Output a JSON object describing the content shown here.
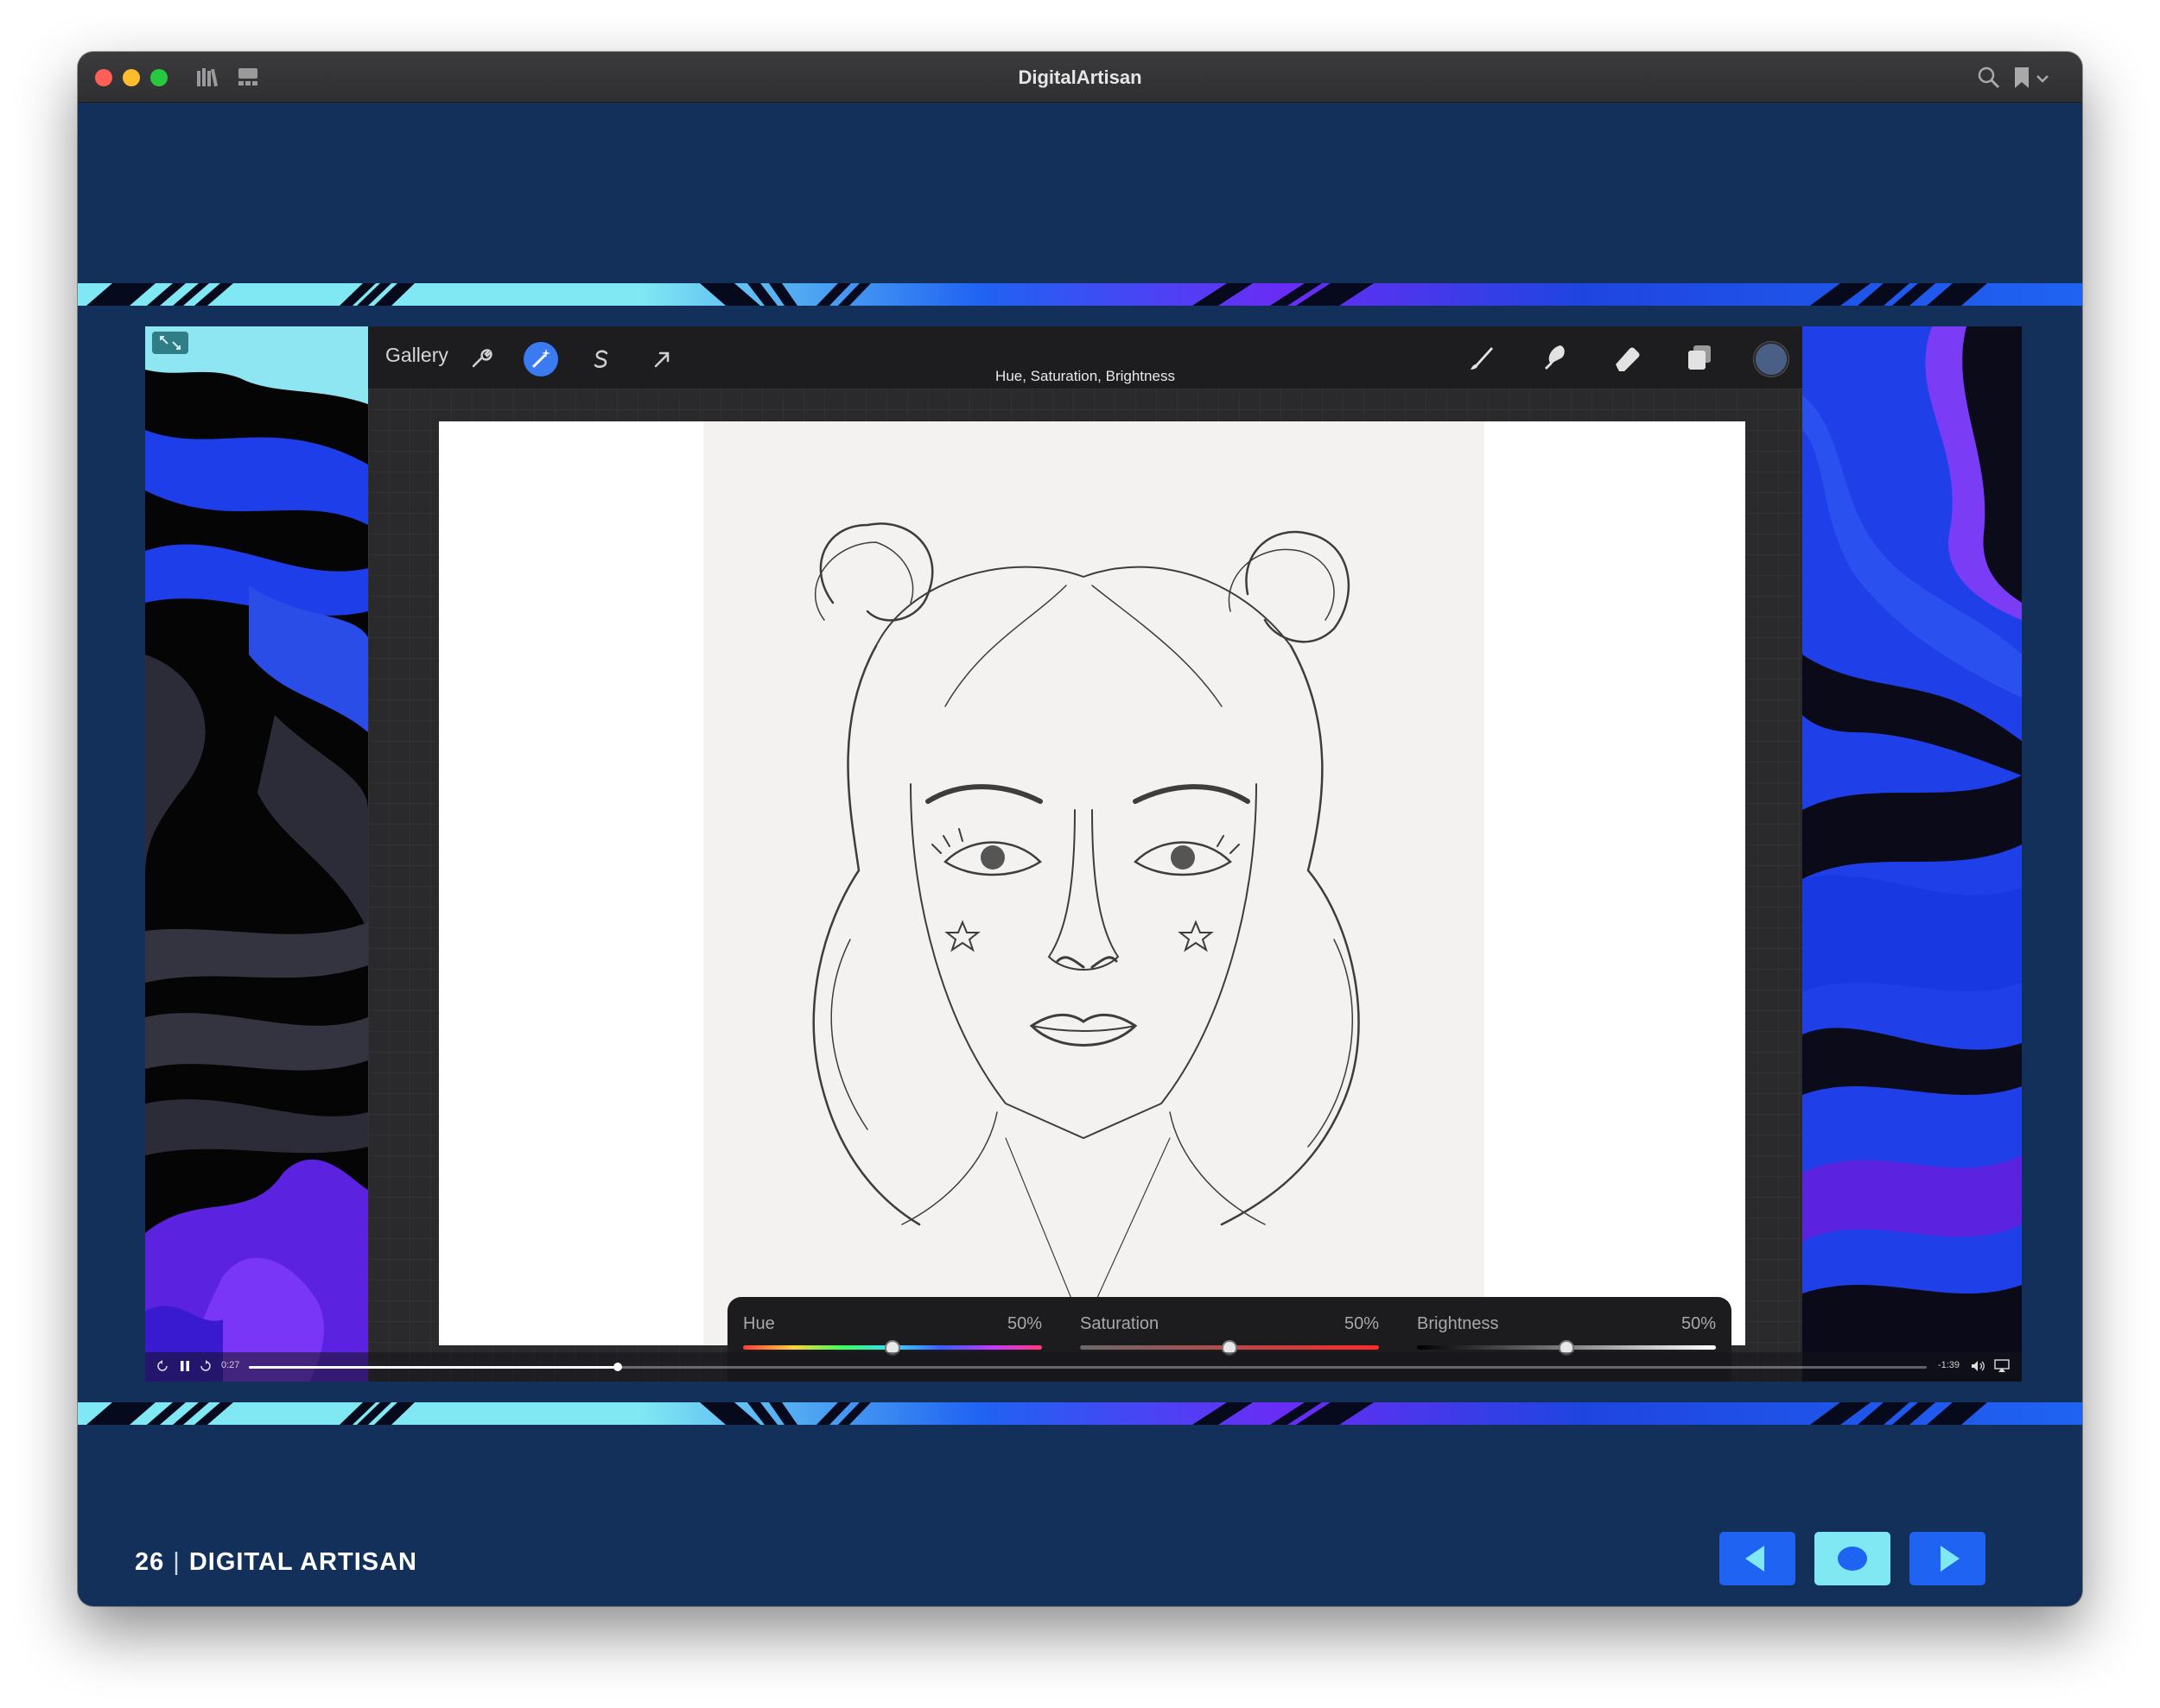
{
  "window": {
    "title": "DigitalArtisan"
  },
  "app": {
    "gallery_label": "Gallery",
    "adjustment_title": "Hue, Saturation, Brightness",
    "tools": [
      "wrench-icon",
      "magic-wand-icon",
      "selection-icon",
      "transform-arrow-icon"
    ],
    "right_tools": [
      "brush-icon",
      "smudge-icon",
      "eraser-icon",
      "layers-icon",
      "color-swatch"
    ],
    "current_color": "#4a5f86",
    "hsb": {
      "hue": {
        "label": "Hue",
        "value": "50%",
        "level": 0.5
      },
      "saturation": {
        "label": "Saturation",
        "value": "50%",
        "level": 0.5
      },
      "brightness": {
        "label": "Brightness",
        "value": "50%",
        "level": 0.5
      }
    }
  },
  "player": {
    "elapsed": "0:27",
    "remaining": "-1:39",
    "progress": 0.22
  },
  "footer": {
    "page_number": "26",
    "publication": "DIGITAL ARTISAN"
  },
  "colors": {
    "page_background": "#13305a",
    "accent_cyan": "#7fe8f3",
    "accent_blue": "#1f63f2",
    "accent_violet": "#6a2cf5"
  }
}
